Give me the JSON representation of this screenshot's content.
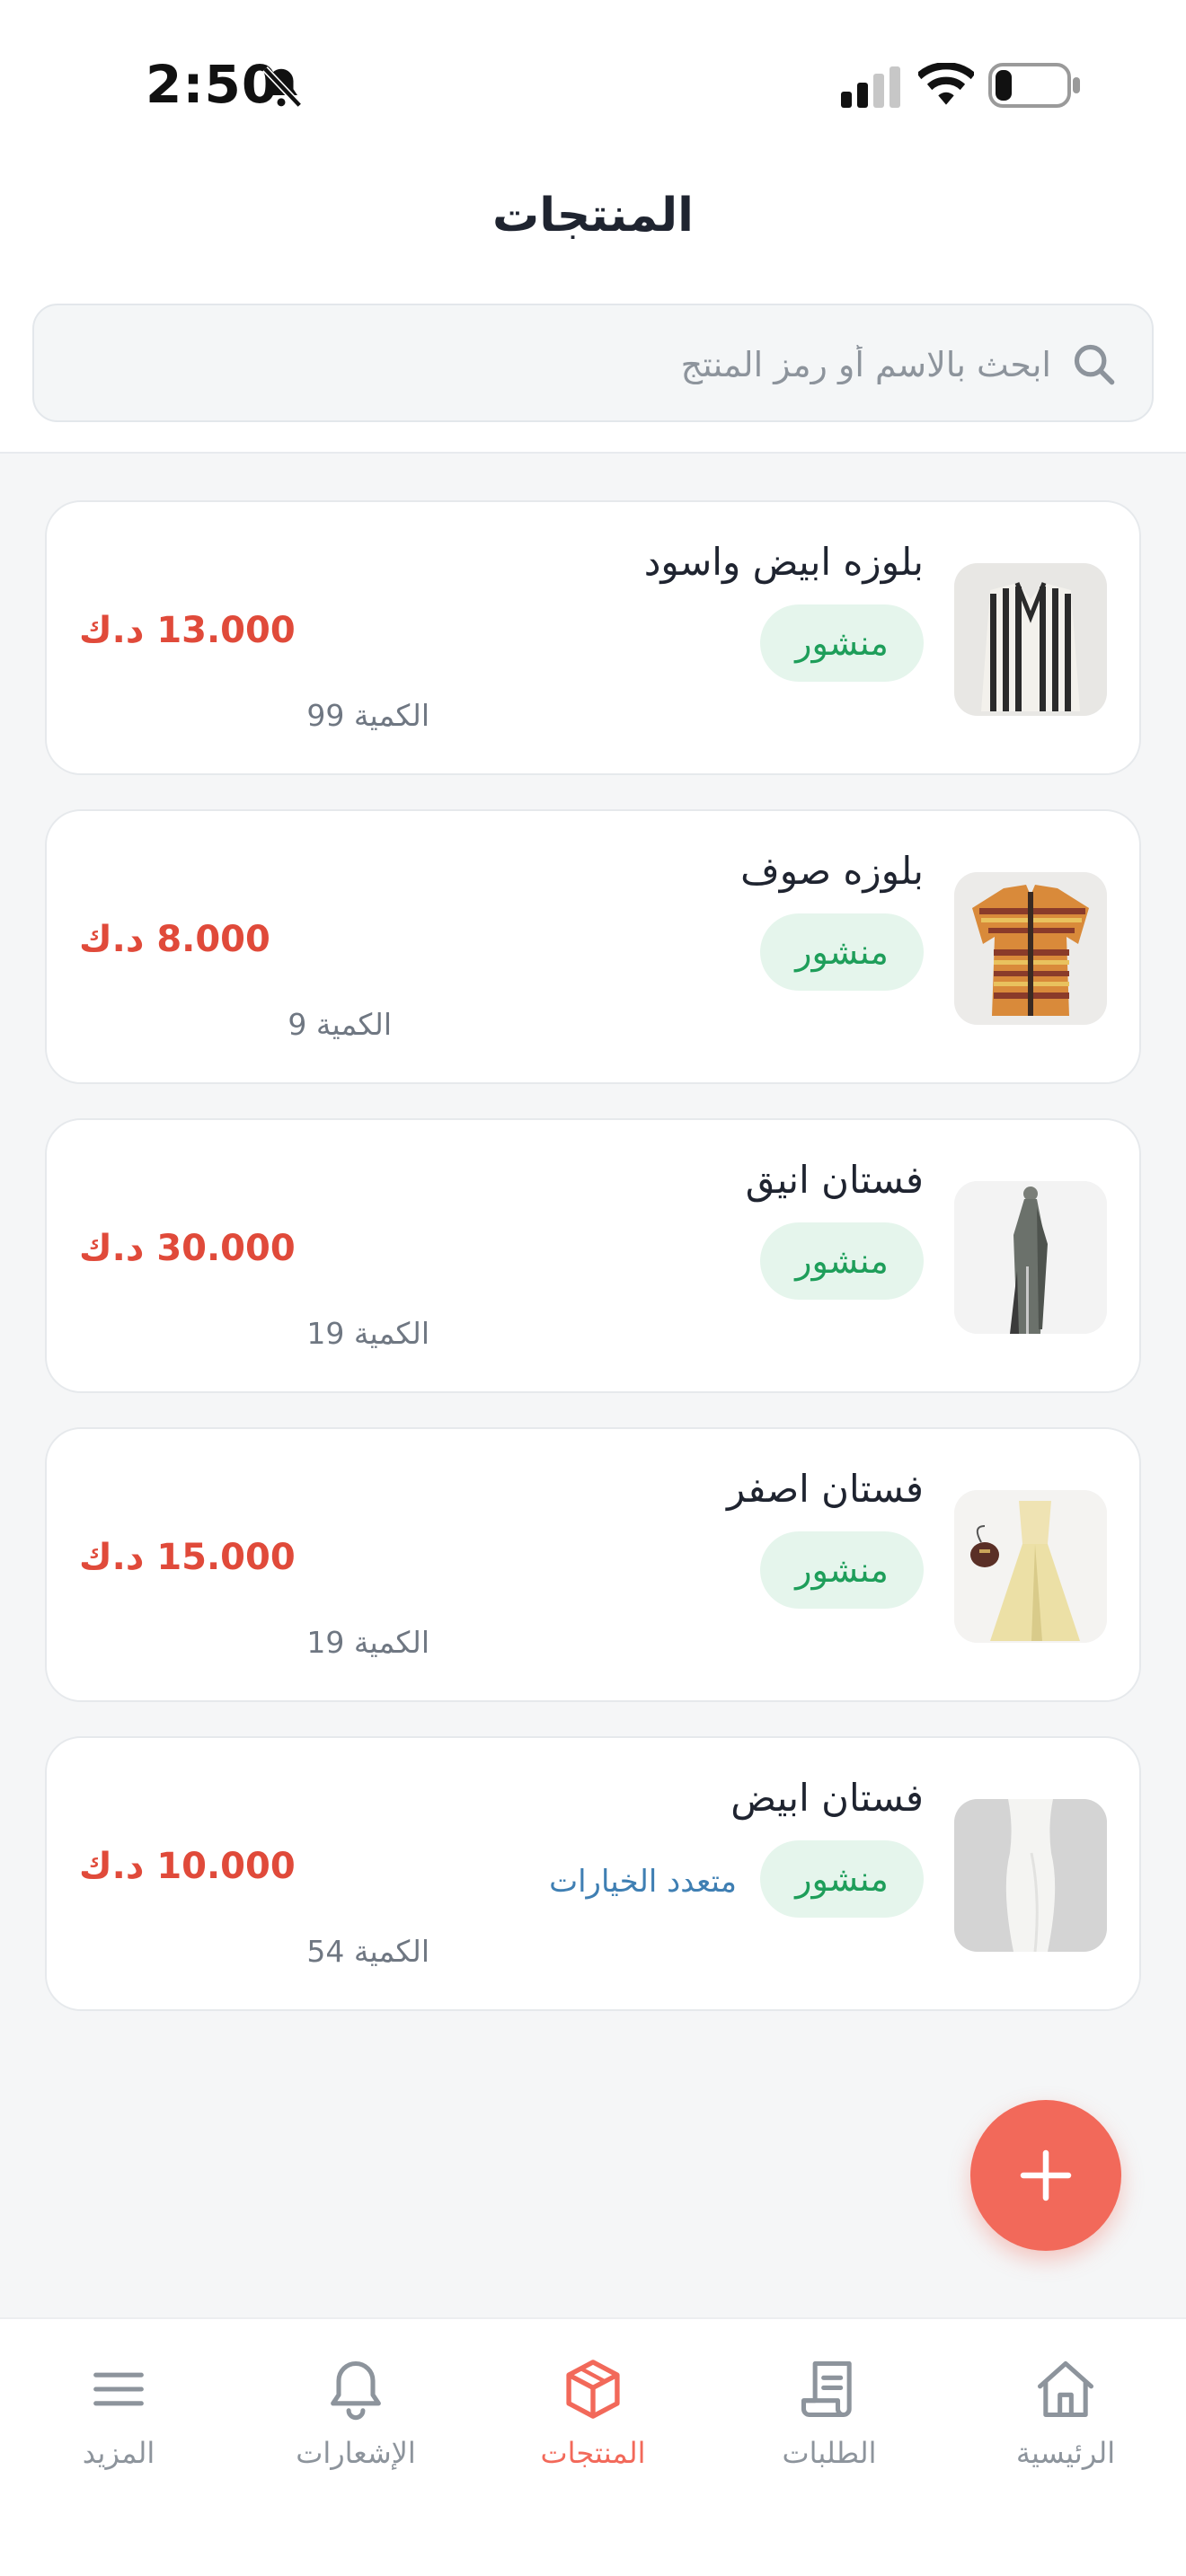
{
  "status_bar": {
    "time": "2:50"
  },
  "header": {
    "title": "المنتجات"
  },
  "search": {
    "placeholder": "ابحث بالاسم أو رمز المنتج"
  },
  "products": [
    {
      "name": "بلوزه ابيض واسود",
      "status": "منشور",
      "price": "13.000 د.ك",
      "quantity": "الكمية 99",
      "variants": ""
    },
    {
      "name": "بلوزه صوف",
      "status": "منشور",
      "price": "8.000 د.ك",
      "quantity": "الكمية 9",
      "variants": ""
    },
    {
      "name": "فستان انيق",
      "status": "منشور",
      "price": "30.000 د.ك",
      "quantity": "الكمية 19",
      "variants": ""
    },
    {
      "name": "فستان اصفر",
      "status": "منشور",
      "price": "15.000 د.ك",
      "quantity": "الكمية 19",
      "variants": ""
    },
    {
      "name": "فستان ابيض",
      "status": "منشور",
      "price": "10.000 د.ك",
      "quantity": "الكمية 54",
      "variants": "متعدد الخيارات"
    }
  ],
  "tabs": [
    {
      "label": "الرئيسية",
      "icon": "home-icon"
    },
    {
      "label": "الطلبات",
      "icon": "receipt-icon"
    },
    {
      "label": "المنتجات",
      "icon": "box-icon",
      "active": true
    },
    {
      "label": "الإشعارات",
      "icon": "bell-icon"
    },
    {
      "label": "المزيد",
      "icon": "menu-icon"
    }
  ],
  "colors": {
    "accent": "#f2695a",
    "price": "#e04a3a",
    "status_bg": "#e5f5ec",
    "status_text": "#1e9e5a",
    "variants": "#3f7fb3"
  }
}
